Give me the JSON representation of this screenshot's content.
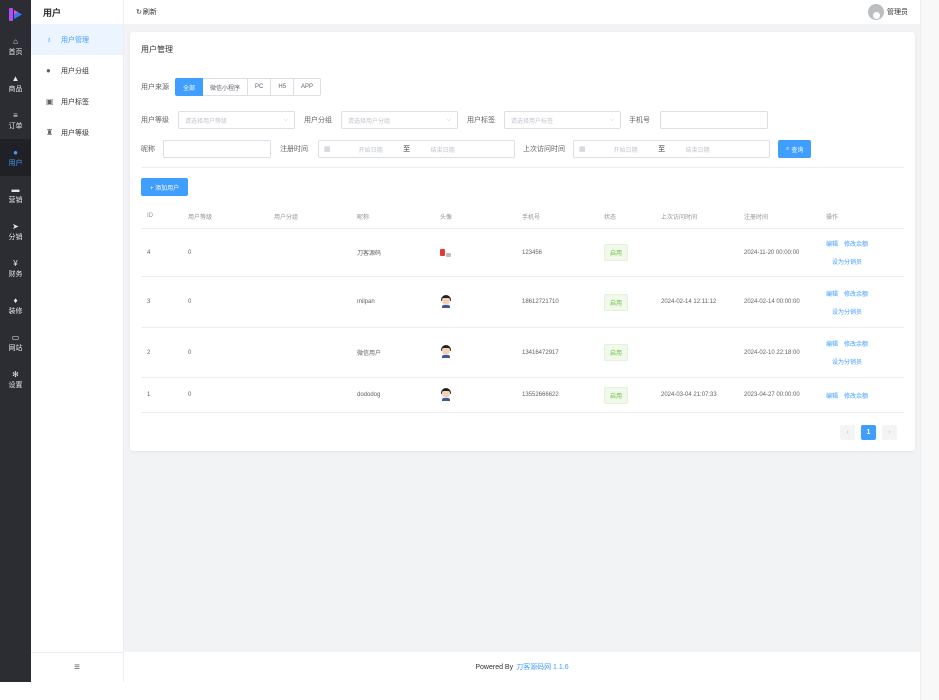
{
  "rail": {
    "items": [
      {
        "label": "首页",
        "icon": "home-icon",
        "glyph": "⌂"
      },
      {
        "label": "商品",
        "icon": "bag-icon",
        "glyph": "▲"
      },
      {
        "label": "订单",
        "icon": "order-icon",
        "glyph": "≡"
      },
      {
        "label": "用户",
        "icon": "user-icon",
        "glyph": "●"
      },
      {
        "label": "营销",
        "icon": "ticket-icon",
        "glyph": "▬"
      },
      {
        "label": "分销",
        "icon": "send-icon",
        "glyph": "➤"
      },
      {
        "label": "财务",
        "icon": "money-icon",
        "glyph": "¥"
      },
      {
        "label": "装修",
        "icon": "brush-icon",
        "glyph": "♦"
      },
      {
        "label": "网站",
        "icon": "monitor-icon",
        "glyph": "▭"
      },
      {
        "label": "设置",
        "icon": "gear-icon",
        "glyph": "✻"
      }
    ]
  },
  "submenu": {
    "title": "用户",
    "items": [
      {
        "label": "用户管理",
        "glyph": "♁"
      },
      {
        "label": "用户分组",
        "glyph": "●"
      },
      {
        "label": "用户标签",
        "glyph": "▣"
      },
      {
        "label": "用户等级",
        "glyph": "♜"
      }
    ],
    "collapse_glyph": "≡"
  },
  "header": {
    "refresh_glyph": "↻",
    "refresh_label": "刷新",
    "user_name": "管理员"
  },
  "card": {
    "title": "用户管理",
    "source_label": "用户来源",
    "sources": [
      "全部",
      "微信小程序",
      "PC",
      "H5",
      "APP"
    ],
    "level_label": "用户等级",
    "level_placeholder": "请选择用户等级",
    "group_label": "用户分组",
    "group_placeholder": "请选择用户分组",
    "tag_label": "用户标签",
    "tag_placeholder": "请选择用户标签",
    "phone_label": "手机号",
    "nick_label": "昵称",
    "reg_label": "注册时间",
    "start_placeholder": "开始日期",
    "range_sep": "至",
    "end_placeholder": "结束日期",
    "visit_label": "上次访问时间",
    "search_glyph": "⌕",
    "search_label": "查询",
    "add_label": "+ 添加用户",
    "chevron": "⌵",
    "calendar_glyph": "▦"
  },
  "table": {
    "headers": [
      "ID",
      "用户等级",
      "用户分组",
      "昵称",
      "头像",
      "手机号",
      "状态",
      "上次访问时间",
      "注册时间",
      "操作"
    ],
    "rows": [
      {
        "id": "4",
        "level": "0",
        "group": "",
        "nick": "刀客源码",
        "avatar": "logo",
        "phone": "123456",
        "status": "启用",
        "last_visit": "",
        "reg": "2024-11-20 00:00:00",
        "op1": "编辑",
        "op2": "修改余额",
        "op3": "设为分销员"
      },
      {
        "id": "3",
        "level": "0",
        "group": "",
        "nick": "milpan",
        "avatar": "face",
        "phone": "18612721710",
        "status": "启用",
        "last_visit": "2024-02-14 12:11:12",
        "reg": "2024-02-14 00:00:00",
        "op1": "编辑",
        "op2": "修改余额",
        "op3": "设为分销员"
      },
      {
        "id": "2",
        "level": "0",
        "group": "",
        "nick": "微信用户",
        "avatar": "face",
        "phone": "13416472917",
        "status": "启用",
        "last_visit": "",
        "reg": "2024-02-10 22:18:00",
        "op1": "编辑",
        "op2": "修改余额",
        "op3": "设为分销员"
      },
      {
        "id": "1",
        "level": "0",
        "group": "",
        "nick": "dododog",
        "avatar": "face",
        "phone": "13552666622",
        "status": "启用",
        "last_visit": "2024-03-04 21:07:33",
        "reg": "2023-04-27 00:00:00",
        "op1": "编辑",
        "op2": "修改余额",
        "op3": ""
      }
    ]
  },
  "pagination": {
    "prev": "‹",
    "current": "1",
    "next": "›"
  },
  "footer": {
    "prefix": "Powered By",
    "brand": "刀客源码网 1.1.6"
  },
  "colors": {
    "primary": "#409eff",
    "rail": "#2b2d33",
    "success": "#67c23a"
  }
}
